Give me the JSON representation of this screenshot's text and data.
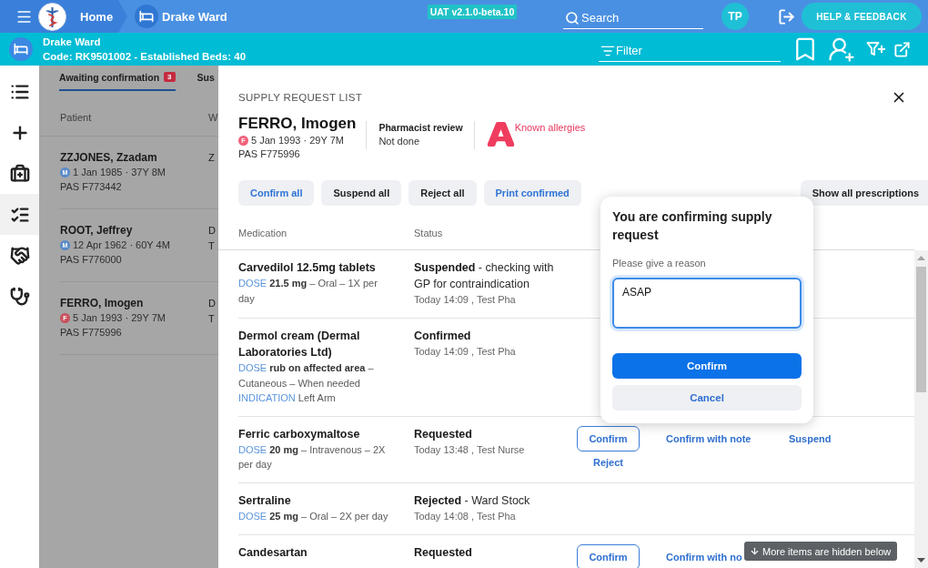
{
  "top_bar": {
    "home": "Home",
    "ward": "Drake Ward",
    "environment": "UAT v2.1.0-beta.10",
    "search": {
      "placeholder": "Search"
    },
    "user_initials": "TP",
    "help_button": "HELP & FEEDBACK"
  },
  "ward_bar": {
    "name": "Drake Ward",
    "details": "Code: RK9501002 - Established Beds: 40",
    "filter": {
      "placeholder": "Filter"
    }
  },
  "sidebar": {
    "items": [
      {
        "kind": "list",
        "selected": false
      },
      {
        "kind": "add",
        "selected": false
      },
      {
        "kind": "medical-kit",
        "selected": false
      },
      {
        "kind": "checklist",
        "selected": true
      },
      {
        "kind": "handshake",
        "selected": false
      },
      {
        "kind": "stethoscope",
        "selected": false
      }
    ]
  },
  "patient_list": {
    "tabs": [
      {
        "label": "Awaiting confirmation",
        "count": "3",
        "selected": true
      },
      {
        "label": "Sus",
        "selected": false
      }
    ],
    "columns": [
      "Patient",
      "W"
    ],
    "rows": [
      {
        "name": "ZZJONES, Zzadam",
        "sex": "M",
        "color": "#5a8bc8",
        "dob": "1 Jan 1985 · 37Y 8M",
        "pas": "PAS F773442",
        "column_2": [
          "Z"
        ]
      },
      {
        "name": "ROOT, Jeffrey",
        "sex": "M",
        "color": "#5a8bc8",
        "dob": "12 Apr 1962 · 60Y 4M",
        "pas": "PAS F776000",
        "column_2": [
          "D",
          "T"
        ]
      },
      {
        "name": "FERRO, Imogen",
        "sex": "F",
        "color": "#c9515f",
        "dob": "5 Jan 1993 · 29Y 7M",
        "pas": "PAS F775996",
        "column_2": [
          "D",
          "T"
        ]
      }
    ]
  },
  "supply_panel": {
    "title": "SUPPLY REQUEST LIST",
    "patient": {
      "name": "FERRO, Imogen",
      "sex": "F",
      "color": "#f0617a",
      "dob": "5 Jan 1993 · 29Y 7M",
      "pas": "PAS F775996"
    },
    "pharmacist_review": {
      "label": "Pharmacist review",
      "value": "Not done"
    },
    "allergies": "Known allergies",
    "actions": [
      {
        "label": "Confirm all",
        "kind": "primary"
      },
      {
        "label": "Suspend all",
        "kind": "neutral"
      },
      {
        "label": "Reject all",
        "kind": "neutral"
      },
      {
        "label": "Print confirmed",
        "kind": "primary"
      }
    ],
    "show_all_button": "Show all prescriptions",
    "columns": [
      "Medication",
      "Status"
    ],
    "rows": [
      {
        "medication": "Carvedilol 12.5mg tablets",
        "details": [
          {
            "label": "DOSE",
            "text": "**21.5 mg** – Oral – 1X per day"
          }
        ],
        "status": "Suspended",
        "note": "- checking with GP for contraindication",
        "updated": "Today 14:09 , Test Pha"
      },
      {
        "medication": "Dermol cream (Dermal Laboratories Ltd)",
        "details": [
          {
            "label": "DOSE",
            "text": "**rub on affected area** – Cutaneous – When needed"
          },
          {
            "label": "INDICATION",
            "text": "Left Arm"
          }
        ],
        "status": "Confirmed",
        "updated": "Today 14:09 , Test Pha"
      },
      {
        "medication": "Ferric carboxymaltose",
        "details": [
          {
            "label": "DOSE",
            "text": "**20 mg** – Intravenous – 2X per day"
          }
        ],
        "status": "Requested",
        "updated": "Today 13:48 , Test Nurse",
        "row_actions": [
          {
            "kind": "confirm",
            "label": "Confirm"
          },
          {
            "kind": "note",
            "label": "Confirm with note"
          },
          {
            "kind": "suspend",
            "label": "Suspend"
          },
          {
            "kind": "reject",
            "label": "Reject"
          }
        ]
      },
      {
        "medication": "Sertraline",
        "details": [
          {
            "label": "DOSE",
            "text": "**25 mg** – Oral – 2X per day"
          }
        ],
        "status": "Rejected",
        "note": "- Ward Stock",
        "updated": "Today 14:08 , Test Pha"
      },
      {
        "medication": "Candesartan",
        "status": "Requested",
        "row_actions": [
          {
            "kind": "confirm",
            "label": "Confirm"
          },
          {
            "kind": "note",
            "label": "Confirm with no"
          }
        ]
      }
    ],
    "scroll_hint": "More items are hidden below"
  },
  "confirm_popover": {
    "title": "You are confirming supply request",
    "label": "Please give a reason",
    "value": "ASAP",
    "confirm_button": "Confirm",
    "cancel_button": "Cancel"
  }
}
